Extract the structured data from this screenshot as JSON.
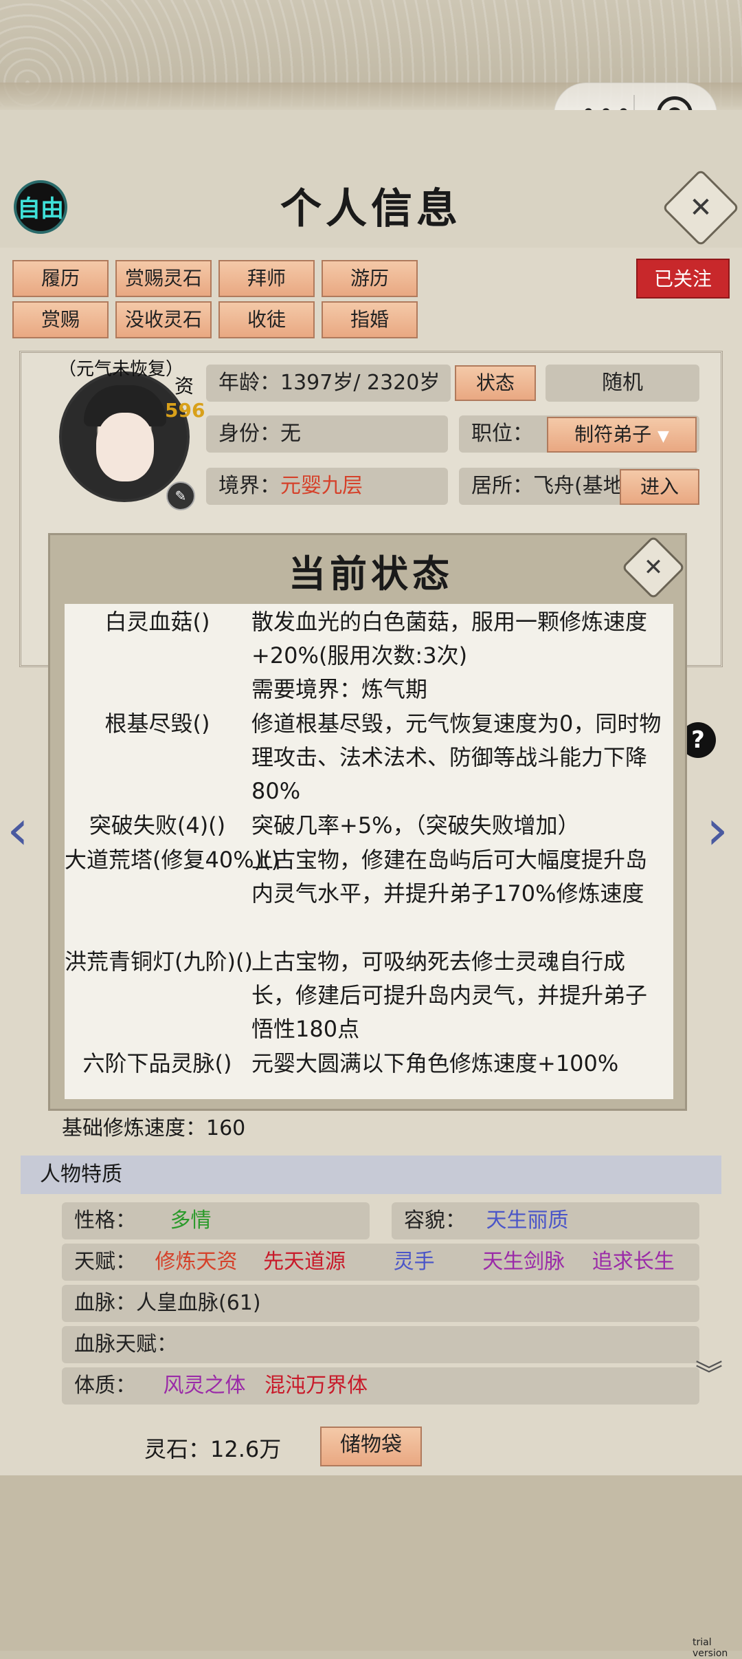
{
  "header": {
    "free_label": "自由",
    "title": "个人信息",
    "close_symbol": "✕",
    "capsule_menu": "•••",
    "followed_label": "已关注"
  },
  "actions": [
    "履历",
    "赏赐灵石",
    "拜师",
    "游历",
    "赏赐",
    "没收灵石",
    "收徒",
    "指婚"
  ],
  "profile": {
    "status_note": "（元气未恢复）",
    "zi_label": "资",
    "zi_value": "596",
    "age_label": "年龄：",
    "age_value": "1397岁/ 2320岁",
    "state_btn": "状态",
    "random_btn": "随机",
    "identity_label": "身份：",
    "identity_value": "无",
    "position_label": "职位：",
    "position_value": "制符弟子",
    "realm_label": "境界：",
    "realm_value": "元婴九层",
    "residence_label": "居所：",
    "residence_value": "飞舟(基地",
    "enter_btn": "进入"
  },
  "modal": {
    "title": "当前状态",
    "close_symbol": "✕",
    "rows": [
      {
        "name": "白灵血菇()",
        "desc": "散发血光的白色菌菇，服用一颗修炼速度+20%(服用次数:3次)\n需要境界：炼气期"
      },
      {
        "name": "根基尽毁()",
        "desc": "修道根基尽毁，元气恢复速度为0，同时物理攻击、法术法术、防御等战斗能力下降80%"
      },
      {
        "name": "突破失败(4)()",
        "desc": "突破几率+5%，（突破失败增加）"
      },
      {
        "name": "大道荒塔(修复40%)()",
        "desc": "上古宝物，修建在岛屿后可大幅度提升岛内灵气水平，并提升弟子170%修炼速度"
      },
      {
        "name": "洪荒青铜灯(九阶)()",
        "desc": "上古宝物，可吸纳死去修士灵魂自行成长，修建后可提升岛内灵气，并提升弟子悟性180点"
      },
      {
        "name": "六阶下品灵脉()",
        "desc": "元婴大圆满以下角色修炼速度+100%"
      }
    ]
  },
  "base_speed": "基础修炼速度：160",
  "traits": {
    "section_title": "人物特质",
    "personality_label": "性格：",
    "personality_value": "多情",
    "looks_label": "容貌：",
    "looks_value": "天生丽质",
    "talent_label": "天赋：",
    "talents": [
      "修炼天资",
      "先天道源",
      "灵手",
      "天生剑脉",
      "追求长生"
    ],
    "bloodline_label": "血脉：",
    "bloodline_value": "人皇血脉(61)",
    "bloodline_talent_label": "血脉天赋：",
    "physique_label": "体质：",
    "physique_values": [
      "风灵之体",
      "混沌万界体"
    ]
  },
  "footer": {
    "stone_text": "灵石：12.6万",
    "bag_label": "储物袋",
    "trial": "trial version"
  },
  "colors": {
    "accent_red": "#d5412a",
    "followed_red": "#c8282b",
    "button_tan": "#f4c9a8"
  }
}
